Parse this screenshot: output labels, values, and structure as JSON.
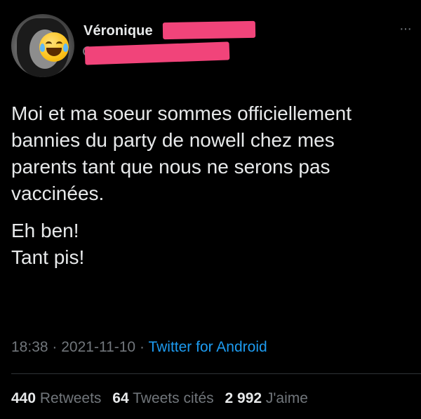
{
  "author": {
    "display_name": "Véronique",
    "avatar_emoji": "face-with-tears-of-joy"
  },
  "tweet": {
    "paragraph_1": "Moi et ma soeur sommes officiellement bannies du party de nowell chez mes parents tant que nous ne serons pas vaccinées.",
    "paragraph_2_line_1": "Eh ben!",
    "paragraph_2_line_2": "Tant pis!"
  },
  "meta": {
    "time": "18:38",
    "separator": "·",
    "date": "2021-11-10",
    "source": "Twitter for Android"
  },
  "stats": {
    "retweets_count": "440",
    "retweets_label": "Retweets",
    "quotes_count": "64",
    "quotes_label": "Tweets cités",
    "likes_count": "2 992",
    "likes_label": "J'aime"
  },
  "colors": {
    "background": "#000000",
    "text": "#e7e9ea",
    "muted": "#71767b",
    "link": "#1d9bf0",
    "redaction": "#f1447a"
  }
}
